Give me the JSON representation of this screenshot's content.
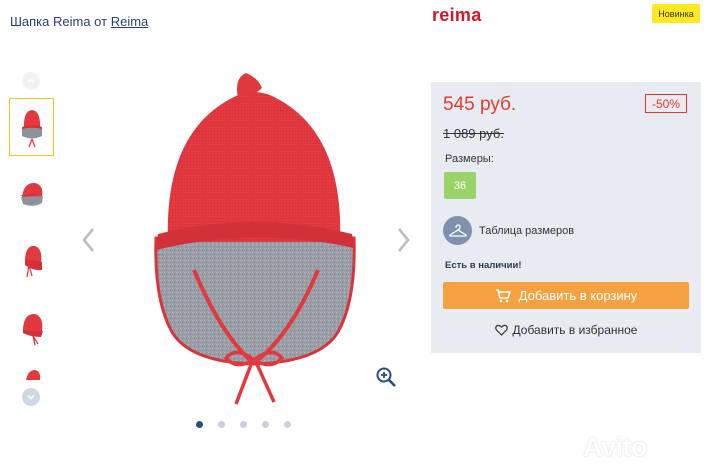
{
  "header": {
    "title_prefix": "Шапка Reima от",
    "brand_link": "Reima"
  },
  "brand_logo": "reima",
  "badge": {
    "label": "Новинка",
    "color": "#ffe81f"
  },
  "gallery": {
    "thumbnails": [
      "thumb-1",
      "thumb-2",
      "thumb-3",
      "thumb-4",
      "thumb-5"
    ],
    "active_thumbnail": 1,
    "dots_count": 5,
    "active_dot": 1
  },
  "product": {
    "price": "545 руб.",
    "discount": "-50%",
    "old_price": "1 089 руб.",
    "sizes_label": "Размеры:",
    "sizes": [
      "36"
    ],
    "size_table_label": "Таблица размеров",
    "stock": "Есть в наличии!",
    "add_to_cart": "Добавить в корзину",
    "add_to_favorites": "Добавить в избранное"
  },
  "colors": {
    "price_red": "#e53a2b",
    "cart_orange": "#f5a13f",
    "size_green": "#9bd36b",
    "panel_bg": "#e8ecf2",
    "hat_red": "#e2383f"
  },
  "icons": [
    "chevron-up-icon",
    "chevron-down-icon",
    "chevron-left-icon",
    "chevron-right-icon",
    "zoom-in-icon",
    "hanger-icon",
    "cart-icon",
    "heart-icon"
  ],
  "watermark": "Avito"
}
